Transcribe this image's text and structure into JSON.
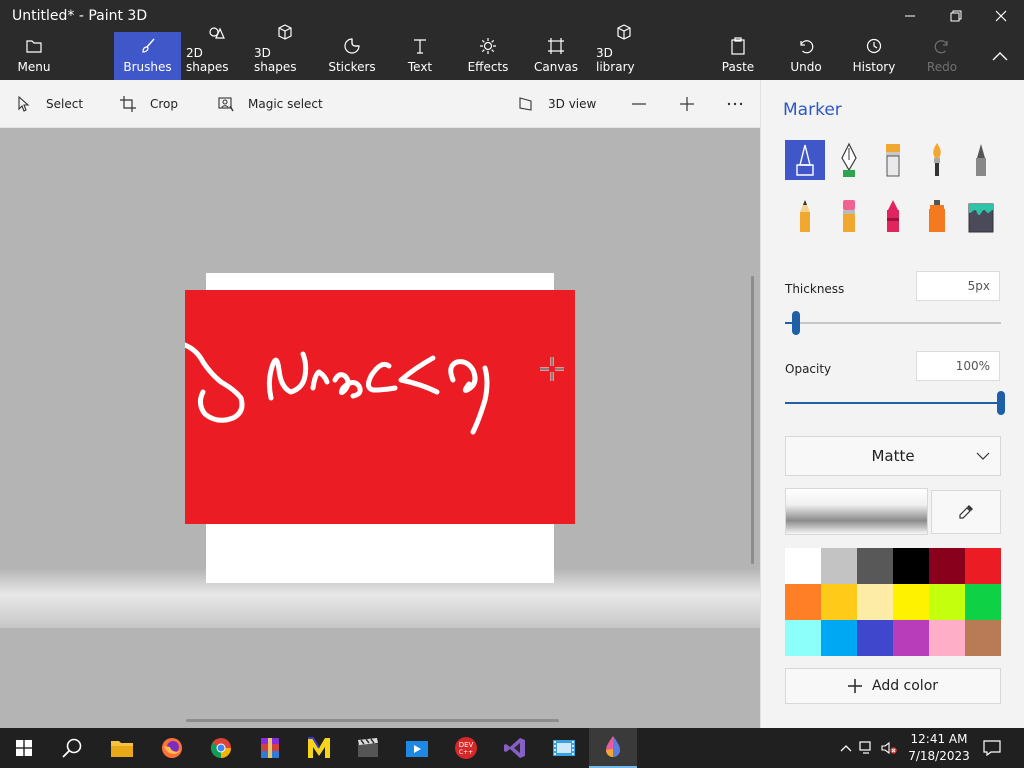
{
  "window": {
    "title": "Untitled* - Paint 3D"
  },
  "ribbon": {
    "menu": "Menu",
    "brushes": "Brushes",
    "shapes2d": "2D shapes",
    "shapes3d": "3D shapes",
    "stickers": "Stickers",
    "text": "Text",
    "effects": "Effects",
    "canvas": "Canvas",
    "library3d": "3D library",
    "paste": "Paste",
    "undo": "Undo",
    "history": "History",
    "redo": "Redo"
  },
  "toolbar": {
    "select": "Select",
    "crop": "Crop",
    "magic_select": "Magic select",
    "view3d": "3D view"
  },
  "panel": {
    "title": "Marker",
    "brushes": [
      "marker",
      "calligraphy-pen",
      "oil-brush",
      "watercolor",
      "pixel-pen",
      "pencil",
      "eraser",
      "crayon",
      "spray-can",
      "fill"
    ],
    "thickness_label": "Thickness",
    "thickness_value": "5px",
    "thickness_fraction": 0.05,
    "opacity_label": "Opacity",
    "opacity_value": "100%",
    "opacity_fraction": 1.0,
    "finish": "Matte",
    "add_color": "Add color",
    "palette": [
      "#ffffff",
      "#c3c3c3",
      "#585858",
      "#000000",
      "#88001b",
      "#ec1c24",
      "#ff7f27",
      "#ffca18",
      "#fdeca6",
      "#fff200",
      "#c4ff0e",
      "#0ed145",
      "#8cfffb",
      "#00a8f3",
      "#3f48cc",
      "#b83dba",
      "#ffaec8",
      "#b97a56"
    ]
  },
  "canvas": {
    "sticker_color": "#ec1c24",
    "stroke_color": "#ffffff"
  },
  "taskbar": {
    "apps": [
      "windows-start",
      "search",
      "file-explorer",
      "firefox",
      "chrome",
      "winrar",
      "app-m",
      "video-editor",
      "media-player",
      "dev-cpp",
      "visual-studio",
      "movie-maker",
      "paint-3d"
    ],
    "time": "12:41 AM",
    "date": "7/18/2023"
  }
}
